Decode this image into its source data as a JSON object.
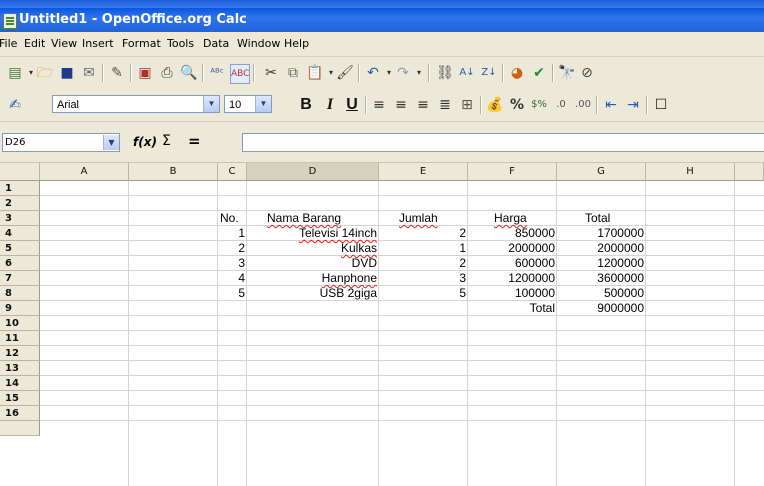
{
  "window": {
    "title": "Untitled1 - OpenOffice.org Calc"
  },
  "menu": [
    "File",
    "Edit",
    "View",
    "Insert",
    "Format",
    "Tools",
    "Data",
    "Window",
    "Help"
  ],
  "format_toolbar": {
    "font_name": "Arial",
    "font_size": "10",
    "bold": "B",
    "italic": "I",
    "underline": "U"
  },
  "formula_bar": {
    "cell_ref": "D26",
    "fx": "f(x)",
    "sigma": "Σ",
    "equals": "="
  },
  "columns": [
    "A",
    "B",
    "C",
    "D",
    "E",
    "F",
    "G",
    "H"
  ],
  "rows": [
    "1",
    "2",
    "3",
    "4",
    "5",
    "6",
    "7",
    "8",
    "9",
    "10",
    "11",
    "12",
    "13",
    "14",
    "15",
    "16"
  ],
  "sheet": {
    "headers": {
      "no": "No.",
      "nama": "Nama Barang",
      "jumlah": "Jumlah",
      "harga": "Harga",
      "total": "Total"
    },
    "items": [
      {
        "no": "1",
        "nama": "Televisi 14inch",
        "jumlah": "2",
        "harga": "850000",
        "total": "1700000"
      },
      {
        "no": "2",
        "nama": "Kulkas",
        "jumlah": "1",
        "harga": "2000000",
        "total": "2000000"
      },
      {
        "no": "3",
        "nama": "DVD",
        "jumlah": "2",
        "harga": "600000",
        "total": "1200000"
      },
      {
        "no": "4",
        "nama": "Hanphone",
        "jumlah": "3",
        "harga": "1200000",
        "total": "3600000"
      },
      {
        "no": "5",
        "nama": "USB 2giga",
        "jumlah": "5",
        "harga": "100000",
        "total": "500000"
      }
    ],
    "grand_total_label": "Total",
    "grand_total_value": "9000000"
  }
}
